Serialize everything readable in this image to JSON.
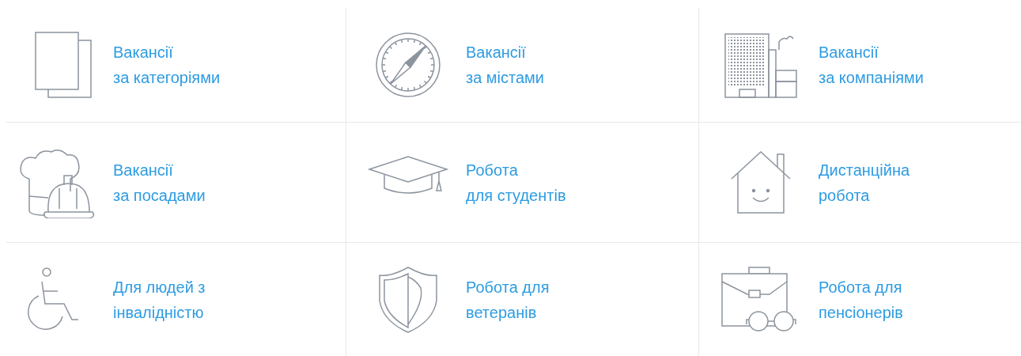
{
  "categories": [
    {
      "kind": "pages",
      "lines": [
        "Вакансії",
        "за категоріями"
      ]
    },
    {
      "kind": "compass",
      "lines": [
        "Вакансії",
        "за містами"
      ]
    },
    {
      "kind": "building",
      "lines": [
        "Вакансії",
        "за компаніями"
      ]
    },
    {
      "kind": "hats",
      "lines": [
        "Вакансії",
        "за посадами"
      ]
    },
    {
      "kind": "graduation-cap",
      "lines": [
        "Робота",
        "для студентів"
      ]
    },
    {
      "kind": "house",
      "lines": [
        "Дистанційна",
        "робота"
      ]
    },
    {
      "kind": "wheelchair",
      "lines": [
        "Для людей з",
        "інвалідністю"
      ]
    },
    {
      "kind": "shield",
      "lines": [
        "Робота для",
        "ветеранів"
      ]
    },
    {
      "kind": "briefcase",
      "lines": [
        "Робота для",
        "пенсіонерів"
      ]
    }
  ]
}
